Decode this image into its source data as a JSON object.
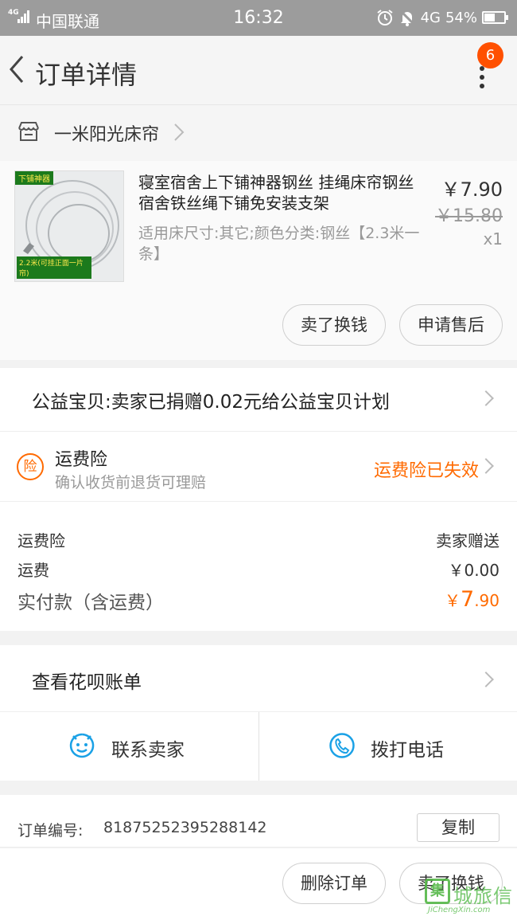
{
  "status_bar": {
    "network": "4G",
    "carrier": "中国联通",
    "time": "16:32",
    "right_network": "4G",
    "battery": "54%",
    "battery_level": 0.54
  },
  "header": {
    "title": "订单详情",
    "badge": "6"
  },
  "shop": {
    "name": "一米阳光床帘"
  },
  "item": {
    "image_tag": "下铺神器",
    "image_caption": "2.2米(可挂正面一片帘)",
    "title": "寝室宿舍上下铺神器钢丝 挂绳床帘钢丝 宿舍铁丝绳下铺免安装支架",
    "sku": "适用床尺寸:其它;颜色分类:钢丝【2.3米一条】",
    "price": "￥7.90",
    "original_price": "￥15.80",
    "quantity": "x1",
    "sell_label": "卖了换钱",
    "refund_label": "申请售后"
  },
  "charity": {
    "text": "公益宝贝:卖家已捐赠0.02元给公益宝贝计划"
  },
  "insurance": {
    "icon_text": "险",
    "title": "运费险",
    "subtitle": "确认收货前退货可理赔",
    "status": "运费险已失效"
  },
  "fees": {
    "insurance_label": "运费险",
    "insurance_value": "卖家赠送",
    "shipping_label": "运费",
    "shipping_value": "￥0.00",
    "paid_label": "实付款（含运费）",
    "paid_currency": "￥",
    "paid_int": "7",
    "paid_dec": ".90"
  },
  "huabei": {
    "text": "查看花呗账单"
  },
  "contact": {
    "seller_label": "联系卖家",
    "phone_label": "拨打电话"
  },
  "order": {
    "number_label": "订单编号:",
    "number": "81875252395288142",
    "copy_label": "复制"
  },
  "actions": {
    "delete_label": "删除订单",
    "sell_label": "卖了换钱"
  },
  "watermark": {
    "mark": "集",
    "cn": "城旅信",
    "en": "JiChengXin.com"
  },
  "colors": {
    "accent": "#ff6a00",
    "badge": "#ff5000",
    "statusbar": "#9c9c9c",
    "icon_blue": "#1aa1e6"
  }
}
